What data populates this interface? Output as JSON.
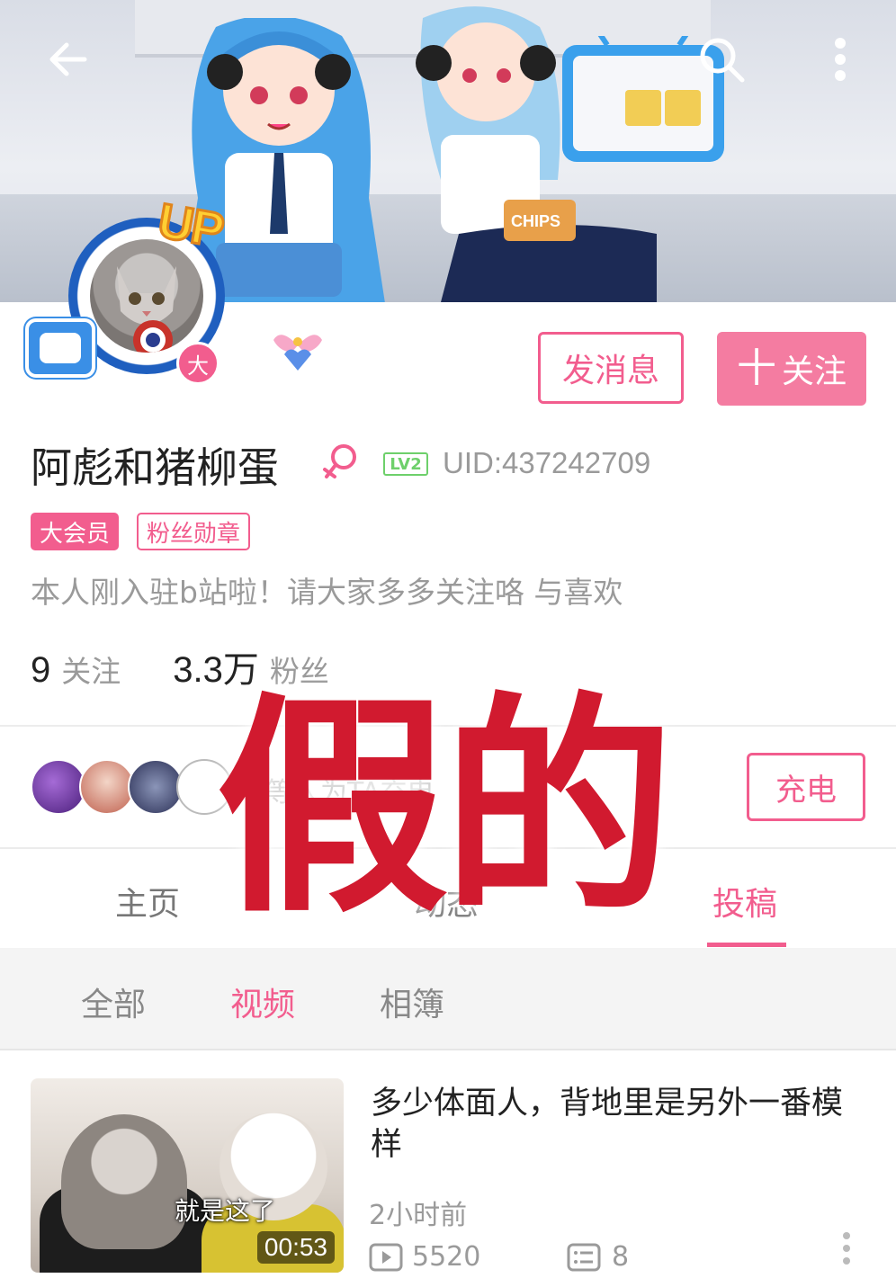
{
  "header": {
    "icons": [
      "back-arrow-icon",
      "search-icon",
      "more-vertical-icon"
    ],
    "banner_text": "CHIPS"
  },
  "profile": {
    "avatar_badge": "UP",
    "vip_corner": "大",
    "username": "阿彪和猪柳蛋",
    "gender": "female",
    "level": "LV2",
    "uid": "UID:437242709",
    "tags": {
      "vip": "大会员",
      "fan_medal": "粉丝勋章"
    },
    "bio": "本人刚入驻b站啦！请大家多多关注咯 与喜欢",
    "following_count": "9",
    "following_label": "关注",
    "followers_count": "3.3万",
    "followers_label": "粉丝"
  },
  "actions": {
    "message_label": "发消息",
    "follow_plus": "十",
    "follow_label": "关注",
    "charge_label": "充电"
  },
  "charge": {
    "text": "等人为TA充电"
  },
  "tabs": {
    "home": "主页",
    "dynamic": "动态",
    "posts": "投稿",
    "active": "posts"
  },
  "subtabs": {
    "all": "全部",
    "video": "视频",
    "album": "相簿",
    "active": "video"
  },
  "video": {
    "caption": "就是这了",
    "duration": "00:53",
    "title": "多少体面人，背地里是另外一番模样",
    "time": "2小时前",
    "plays": "5520",
    "comments": "8"
  },
  "overlay": {
    "stamp_text": "假的"
  },
  "colors": {
    "accent": "#f25d8e",
    "follow_bg": "#f47ca1",
    "level": "#6ed06b",
    "stamp": "#d11a2f"
  }
}
